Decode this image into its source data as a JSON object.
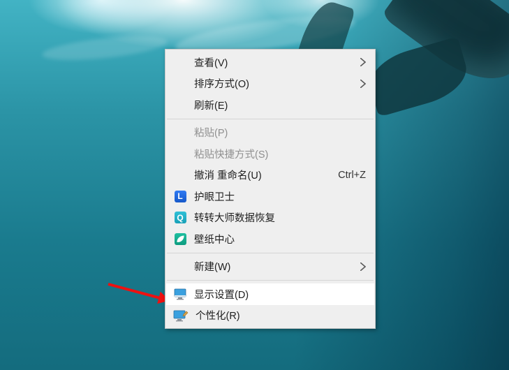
{
  "menu": {
    "items": [
      {
        "id": "view",
        "label": "查看(V)",
        "submenu": true
      },
      {
        "id": "sort",
        "label": "排序方式(O)",
        "submenu": true
      },
      {
        "id": "refresh",
        "label": "刷新(E)"
      },
      {
        "sep": true
      },
      {
        "id": "paste",
        "label": "粘贴(P)",
        "disabled": true
      },
      {
        "id": "paste-shortcut",
        "label": "粘贴快捷方式(S)",
        "disabled": true
      },
      {
        "id": "undo-rename",
        "label": "撤消 重命名(U)",
        "accel": "Ctrl+Z"
      },
      {
        "id": "eye-guard",
        "label": "护眼卫士",
        "icon": "blue",
        "glyph": "L"
      },
      {
        "id": "data-recovery",
        "label": "转转大师数据恢复",
        "icon": "cyan",
        "glyph": "Q"
      },
      {
        "id": "wallpaper-center",
        "label": "壁纸中心",
        "icon": "teal",
        "glyph": ""
      },
      {
        "sep": true
      },
      {
        "id": "new",
        "label": "新建(W)",
        "submenu": true
      },
      {
        "sep": true
      },
      {
        "id": "display",
        "label": "显示设置(D)",
        "icon": "monitor",
        "highlight": true
      },
      {
        "id": "personalize",
        "label": "个性化(R)",
        "icon": "monitor-paint"
      }
    ]
  }
}
